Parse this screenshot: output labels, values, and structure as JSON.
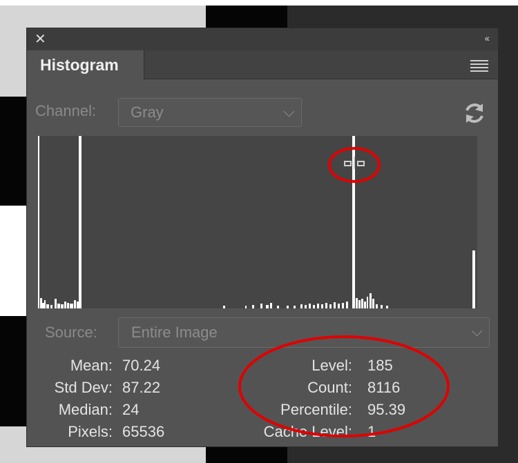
{
  "panel": {
    "close_glyph": "✕",
    "collapse_glyph": "‹‹",
    "tab_label": "Histogram"
  },
  "channel": {
    "label": "Channel:",
    "value": "Gray"
  },
  "source": {
    "label": "Source:",
    "value": "Entire Image"
  },
  "stats_left": [
    {
      "label": "Mean:",
      "value": "70.24"
    },
    {
      "label": "Std Dev:",
      "value": "87.22"
    },
    {
      "label": "Median:",
      "value": "24"
    },
    {
      "label": "Pixels:",
      "value": "65536"
    }
  ],
  "stats_right": [
    {
      "label": "Level:",
      "value": "185"
    },
    {
      "label": "Count:",
      "value": "8116"
    },
    {
      "label": "Percentile:",
      "value": "95.39"
    },
    {
      "label": "Cache Level:",
      "value": "1"
    }
  ],
  "colors": {
    "panel_bg": "#535353",
    "annotation_red": "#e00000",
    "histogram_bar": "#ffffff"
  }
}
